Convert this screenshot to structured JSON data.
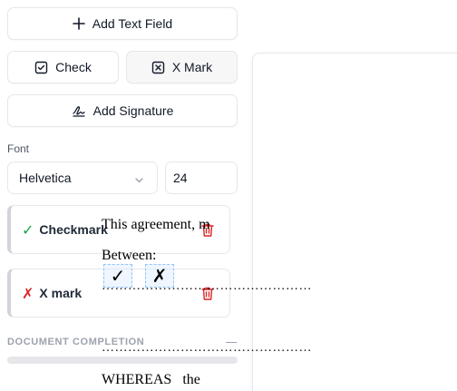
{
  "toolbar": {
    "add_text_field": "Add Text Field",
    "check": "Check",
    "x_mark": "X Mark",
    "add_signature": "Add Signature"
  },
  "font": {
    "label": "Font",
    "family": "Helvetica",
    "size": "24"
  },
  "fields": [
    {
      "glyph": "✓",
      "label": "Checkmark",
      "color": "#16a34a"
    },
    {
      "glyph": "✗",
      "label": "X mark",
      "color": "#dc2626"
    }
  ],
  "completion": {
    "title": "DOCUMENT COMPLETION",
    "progress": 0
  },
  "document": {
    "line1": "This agreement, m",
    "line2": "Between:",
    "dots1": "…………………………………………",
    "dots2": "…………………………………………",
    "line3": "WHEREAS the",
    "check_mark": "✓",
    "x_mark": "✗"
  },
  "colors": {
    "trash": "#dc2626",
    "accent_border": "#d1d5db"
  }
}
